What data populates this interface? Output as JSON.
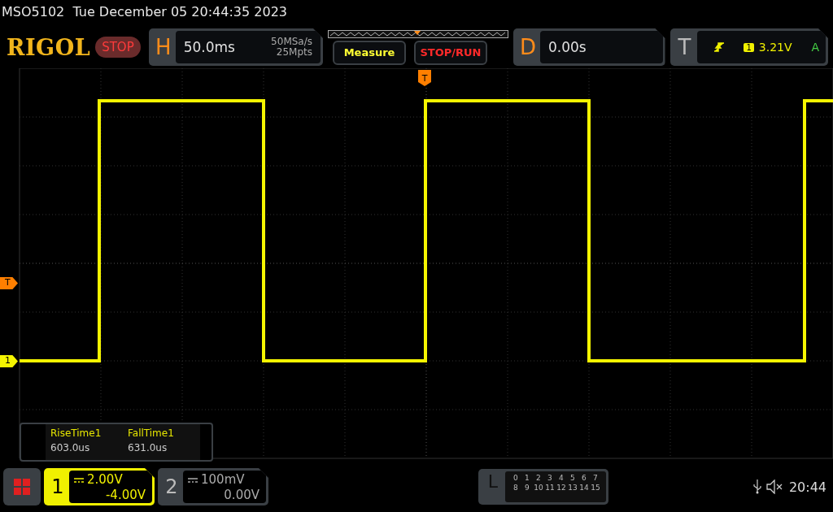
{
  "title": "MSO5102  Tue December 05 20:44:35 2023",
  "logo": "RIGOL",
  "run_state": {
    "label": "STOP",
    "kind": "stopped"
  },
  "horizontal": {
    "label": "H",
    "timebase": "50.0ms",
    "sample_rate": "50MSa/s",
    "memory_depth": "25Mpts"
  },
  "buttons": [
    {
      "label": "Measure",
      "kind": "menu"
    },
    {
      "label": "STOP/RUN",
      "kind": "run"
    }
  ],
  "delay": {
    "label": "D",
    "value": "0.00s"
  },
  "trigger": {
    "label": "T",
    "source": "1",
    "level": "3.21V",
    "mode": "A"
  },
  "markers": {
    "trigger_position": "T",
    "trigger_level": "T",
    "channel": "1"
  },
  "measurements": [
    {
      "name": "RiseTime1",
      "value": "603.0us"
    },
    {
      "name": "FallTime1",
      "value": "631.0us"
    }
  ],
  "channels": [
    {
      "number": "1",
      "scale": "2.00V",
      "offset": "-4.00V",
      "selected": true
    },
    {
      "number": "2",
      "scale": "100mV",
      "offset": "0.00V",
      "selected": false
    }
  ],
  "logic": {
    "label": "L",
    "rows": [
      [
        "0",
        "1",
        "2",
        "3",
        "4",
        "5",
        "6",
        "7"
      ],
      [
        "8",
        "9",
        "10",
        "11",
        "12",
        "13",
        "14",
        "15"
      ]
    ]
  },
  "status": {
    "sound_muted": true,
    "clock": "20:44"
  }
}
